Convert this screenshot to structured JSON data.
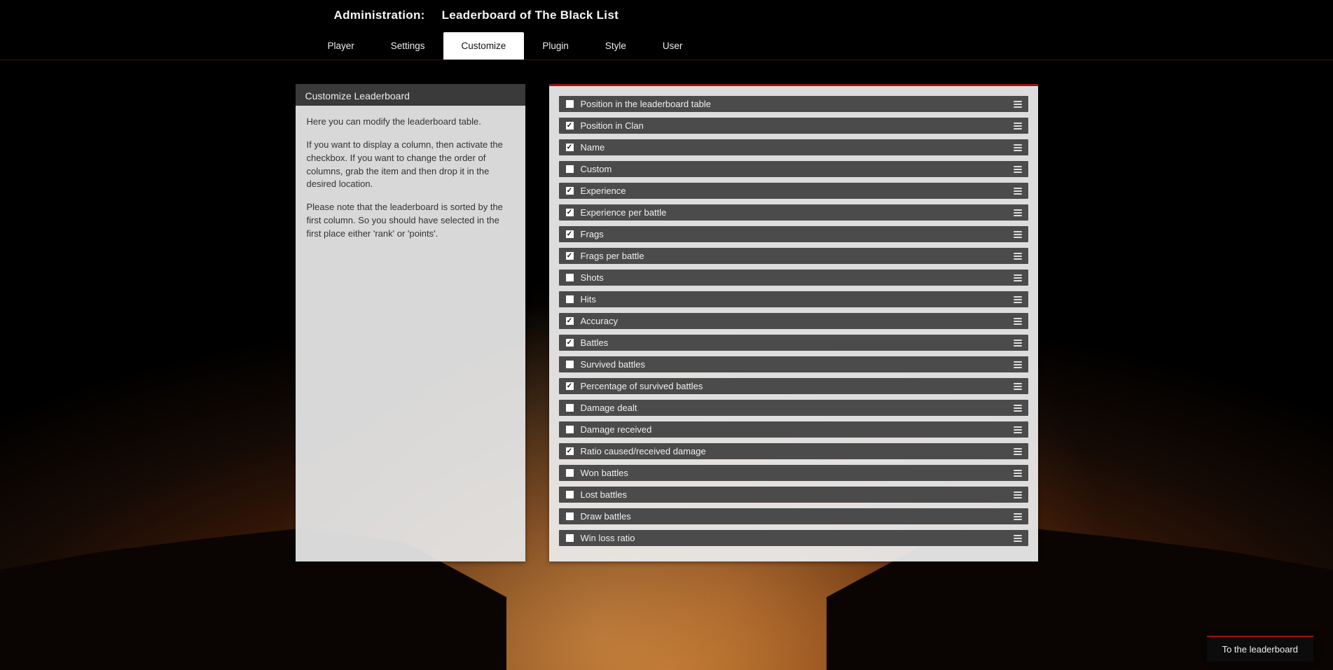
{
  "header": {
    "admin_label": "Administration:",
    "leaderboard_name": "Leaderboard of The Black List"
  },
  "tabs": [
    {
      "id": "player",
      "label": "Player",
      "active": false
    },
    {
      "id": "settings",
      "label": "Settings",
      "active": false
    },
    {
      "id": "customize",
      "label": "Customize",
      "active": true
    },
    {
      "id": "plugin",
      "label": "Plugin",
      "active": false
    },
    {
      "id": "style",
      "label": "Style",
      "active": false
    },
    {
      "id": "user",
      "label": "User",
      "active": false
    }
  ],
  "info_panel": {
    "title": "Customize Leaderboard",
    "p1": "Here you can modify the leaderboard table.",
    "p2": "If you want to display a column, then activate the checkbox. If you want to change the order of columns, grab the item and then drop it in the desired location.",
    "p3": "Please note that the leaderboard is sorted by the first column. So you should have selected in the first place either 'rank' or 'points'."
  },
  "columns": [
    {
      "id": "position-table",
      "label": "Position in the leaderboard table",
      "checked": false
    },
    {
      "id": "position-clan",
      "label": "Position in Clan",
      "checked": true
    },
    {
      "id": "name",
      "label": "Name",
      "checked": true
    },
    {
      "id": "custom",
      "label": "Custom",
      "checked": false
    },
    {
      "id": "experience",
      "label": "Experience",
      "checked": true
    },
    {
      "id": "experience-per-battle",
      "label": "Experience per battle",
      "checked": true
    },
    {
      "id": "frags",
      "label": "Frags",
      "checked": true
    },
    {
      "id": "frags-per-battle",
      "label": "Frags per battle",
      "checked": true
    },
    {
      "id": "shots",
      "label": "Shots",
      "checked": false
    },
    {
      "id": "hits",
      "label": "Hits",
      "checked": false
    },
    {
      "id": "accuracy",
      "label": "Accuracy",
      "checked": true
    },
    {
      "id": "battles",
      "label": "Battles",
      "checked": true
    },
    {
      "id": "survived-battles",
      "label": "Survived battles",
      "checked": false
    },
    {
      "id": "pct-survived",
      "label": "Percentage of survived battles",
      "checked": true
    },
    {
      "id": "damage-dealt",
      "label": "Damage dealt",
      "checked": false
    },
    {
      "id": "damage-received",
      "label": "Damage received",
      "checked": false
    },
    {
      "id": "ratio-damage",
      "label": "Ratio caused/received damage",
      "checked": true
    },
    {
      "id": "won-battles",
      "label": "Won battles",
      "checked": false
    },
    {
      "id": "lost-battles",
      "label": "Lost battles",
      "checked": false
    },
    {
      "id": "draw-battles",
      "label": "Draw battles",
      "checked": false
    },
    {
      "id": "win-loss-ratio",
      "label": "Win loss ratio",
      "checked": false
    }
  ],
  "footer": {
    "to_leaderboard": "To the leaderboard"
  }
}
